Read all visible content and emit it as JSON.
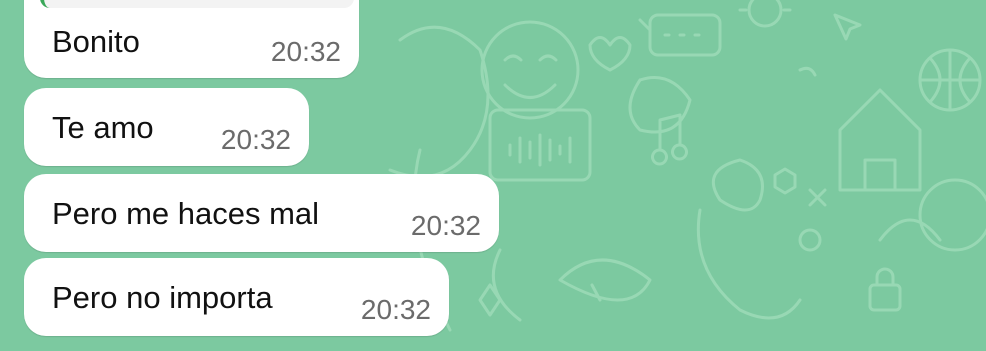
{
  "messages": [
    {
      "text": "Bonito",
      "time": "20:32"
    },
    {
      "text": "Te amo",
      "time": "20:32"
    },
    {
      "text": "Pero me haces mal",
      "time": "20:32"
    },
    {
      "text": "Pero no importa",
      "time": "20:32"
    }
  ],
  "wallpaper": {
    "color": "#7cc9a0",
    "doodle_color": "#98d8b4"
  },
  "bubble_color": "#ffffff"
}
